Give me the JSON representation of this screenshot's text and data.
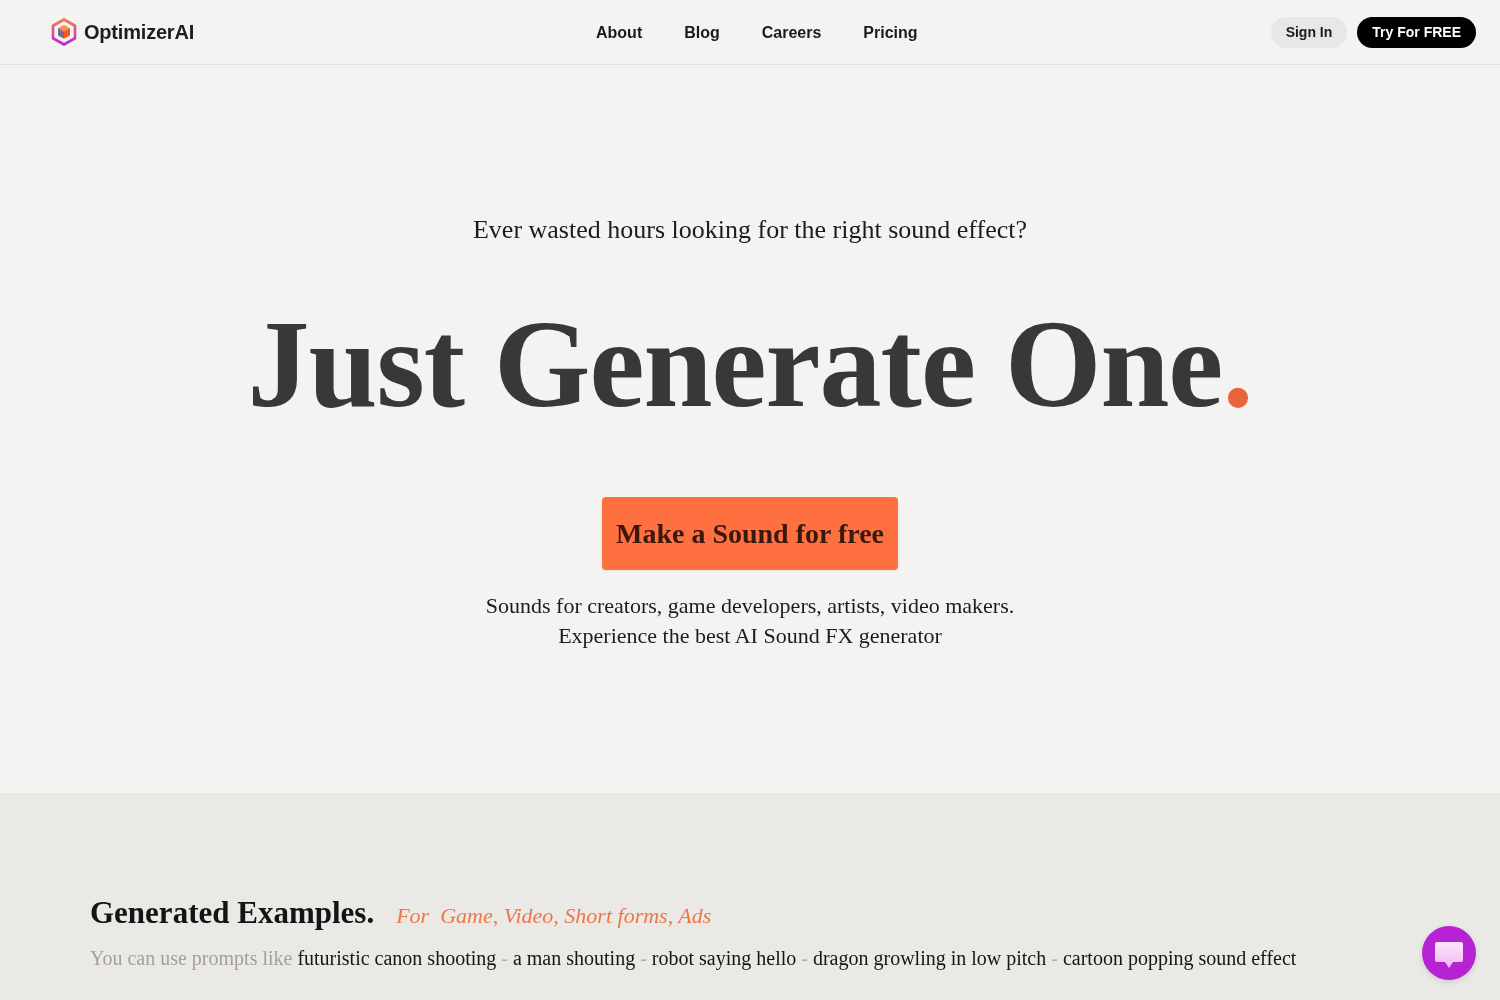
{
  "header": {
    "logo": "OptimizerAI",
    "nav": [
      {
        "label": "About"
      },
      {
        "label": "Blog"
      },
      {
        "label": "Careers"
      },
      {
        "label": "Pricing"
      }
    ],
    "sign_in": "Sign In",
    "cta": "Try For FREE"
  },
  "hero": {
    "tagline": "Ever wasted hours looking for the right sound effect?",
    "headline": "Just Generate One",
    "headline_mark": ".",
    "button": "Make a Sound for free",
    "subtext": [
      "Sounds for creators, game developers, artists, video makers.",
      "Experience the best AI Sound FX generator"
    ]
  },
  "examples": {
    "title": "Generated Examples.",
    "uses": "For  Game, Video, Short forms, Ads",
    "lead": "You can use prompts like",
    "prompts": [
      "futuristic canon shooting",
      "a man shouting",
      "robot saying hello",
      "dragon growling in low pitch",
      "cartoon popping sound effect"
    ],
    "separators": [
      "-",
      "-",
      "-",
      "-"
    ]
  }
}
